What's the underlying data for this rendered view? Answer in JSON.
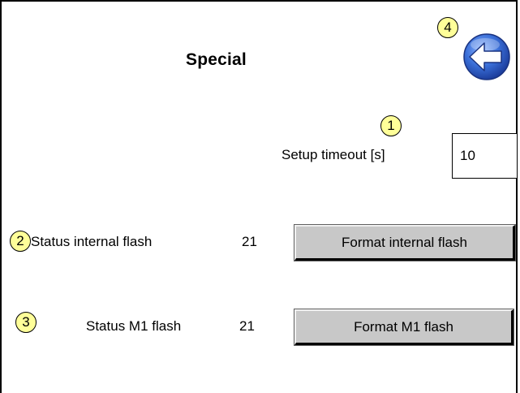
{
  "page": {
    "title": "Special"
  },
  "setup_timeout": {
    "label": "Setup timeout [s]",
    "value": "10"
  },
  "internal_flash": {
    "label": "Status internal flash",
    "status": "21",
    "button_label": "Format internal flash"
  },
  "m1_flash": {
    "label": "Status M1 flash",
    "status": "21",
    "button_label": "Format M1 flash"
  },
  "markers": {
    "m1": "1",
    "m2": "2",
    "m3": "3",
    "m4": "4"
  },
  "icons": {
    "back": "back-arrow-icon"
  },
  "colors": {
    "marker_fill": "#ffff99",
    "button_face": "#c8c8c8",
    "back_button_blue": "#3a6fd8"
  }
}
